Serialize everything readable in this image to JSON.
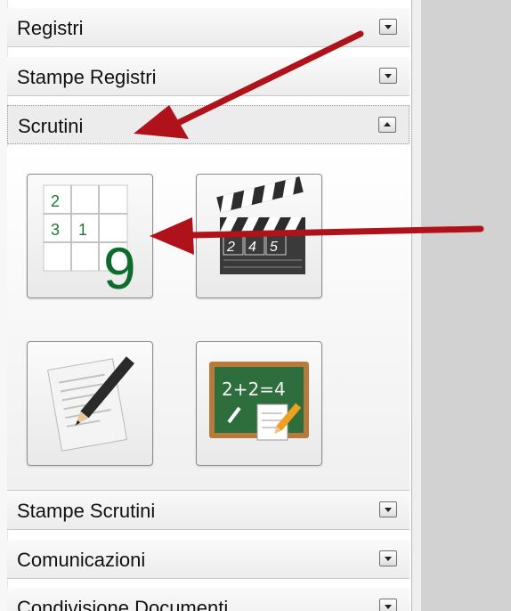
{
  "sections": {
    "registri": {
      "label": "Registri",
      "toggle": "expand-down"
    },
    "stampe_registri": {
      "label": "Stampe Registri",
      "toggle": "expand-down"
    },
    "scrutini": {
      "label": "Scrutini",
      "toggle": "collapse-up"
    },
    "stampe_scrutini": {
      "label": "Stampe Scrutini",
      "toggle": "expand-down"
    },
    "comunicazioni": {
      "label": "Comunicazioni",
      "toggle": "expand-down"
    },
    "condivisione": {
      "label": "Condivisione Documenti",
      "toggle": "expand-down"
    }
  },
  "scrutini_tiles": [
    {
      "icon": "grades-grid-icon",
      "cells": [
        "2",
        "3",
        "1"
      ],
      "big_digit": "9"
    },
    {
      "icon": "clapperboard-icon",
      "digits": [
        "2",
        "4",
        "5"
      ]
    },
    {
      "icon": "document-pencil-icon"
    },
    {
      "icon": "chalkboard-icon",
      "board_text": "2+2=4"
    }
  ],
  "colors": {
    "arrow": "#b0121b",
    "grid_digit": "#1a7a3a",
    "big_digit": "#0d6b2c",
    "chalkboard": "#2e6e3d"
  }
}
